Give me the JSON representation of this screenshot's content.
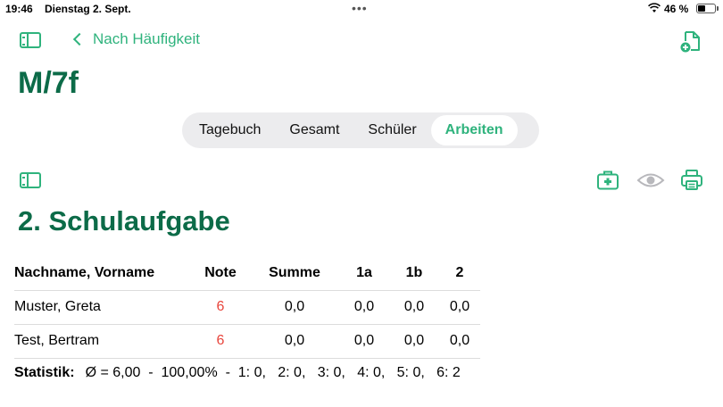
{
  "status_bar": {
    "time": "19:46",
    "date": "Dienstag 2. Sept.",
    "dots": "•••",
    "battery_percent": "46 %",
    "battery_level": 0.46
  },
  "nav": {
    "back_label": "Nach Häufigkeit"
  },
  "class_title": "M/7f",
  "tabs": [
    {
      "label": "Tagebuch",
      "active": false
    },
    {
      "label": "Gesamt",
      "active": false
    },
    {
      "label": "Schüler",
      "active": false
    },
    {
      "label": "Arbeiten",
      "active": true
    }
  ],
  "toolbar_icons": [
    "sidebar-icon",
    "first-aid-icon",
    "eye-icon",
    "printer-icon",
    "new-document-icon"
  ],
  "exam_title": "2. Schulaufgabe",
  "table": {
    "headers": [
      "Nachname, Vorname",
      "Note",
      "Summe",
      "1a",
      "1b",
      "2"
    ],
    "rows": [
      [
        "Muster, Greta",
        "6",
        "0,0",
        "0,0",
        "0,0",
        "0,0"
      ],
      [
        "Test, Bertram",
        "6",
        "0,0",
        "0,0",
        "0,0",
        "0,0"
      ]
    ]
  },
  "stats": {
    "label": "Statistik:",
    "text": "Ø = 6,00  -  100,00%  -  1: 0,   2: 0,   3: 0,   4: 0,   5: 0,   6: 2"
  },
  "colors": {
    "accent": "#2fb37d",
    "title": "#0c6b48",
    "grade_fail": "#e8453c"
  }
}
